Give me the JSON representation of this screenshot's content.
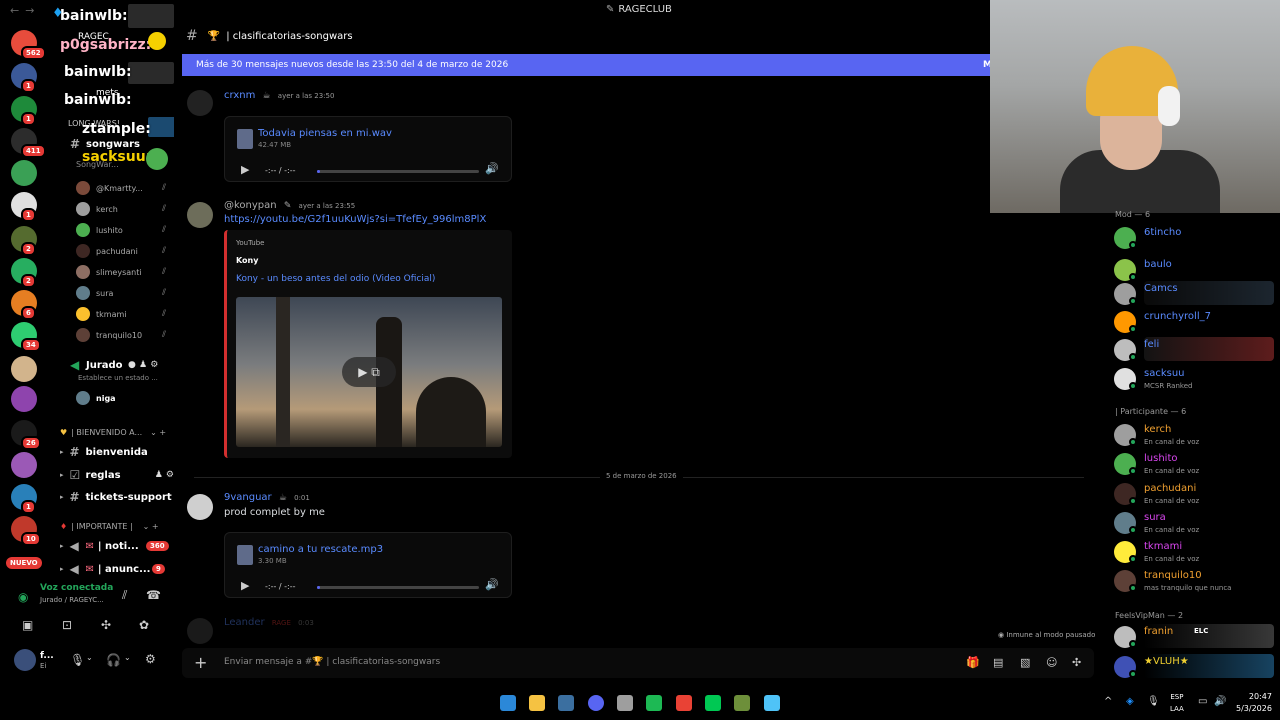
{
  "titlebar": {
    "server_name": "RAGECLUB"
  },
  "server_rail": {
    "servers": [
      {
        "name": "server-1",
        "badge": "562",
        "color": "#e74c3c"
      },
      {
        "name": "server-2",
        "badge": "1",
        "color": "#3b5998"
      },
      {
        "name": "server-3",
        "badge": "1",
        "color": "#1e8a3a"
      },
      {
        "name": "server-4",
        "badge": "411",
        "color": "#2c2c2c"
      },
      {
        "name": "server-5",
        "badge": "",
        "color": "#3aa055"
      },
      {
        "name": "server-6",
        "badge": "1",
        "color": "#e0e0e0"
      },
      {
        "name": "server-7",
        "badge": "2",
        "color": "#556b2f"
      },
      {
        "name": "server-8",
        "badge": "2",
        "color": "#27ae60"
      },
      {
        "name": "server-9",
        "badge": "6",
        "color": "#e67e22"
      },
      {
        "name": "server-10",
        "badge": "34",
        "color": "#2ecc71"
      },
      {
        "name": "server-11",
        "badge": "",
        "color": "#d2b48c"
      },
      {
        "name": "server-12",
        "badge": "",
        "color": "#8e44ad"
      },
      {
        "name": "server-13",
        "badge": "26",
        "color": "#1a1a1a"
      },
      {
        "name": "server-14",
        "badge": "",
        "color": "#9b59b6"
      },
      {
        "name": "server-15",
        "badge": "1",
        "color": "#2980b9"
      },
      {
        "name": "server-16",
        "badge": "10",
        "color": "#c0392b"
      }
    ],
    "nuevo_label": "NUEVO"
  },
  "sidebar": {
    "overlay_names": [
      "bainwlb:",
      "p0gsabrizz:",
      "bainwlb:",
      "bainwlb:",
      "ztample:",
      "sacksuu:"
    ],
    "overlay_small": [
      "RAGEC",
      "mets",
      "LONG WARS!",
      "SongWar..."
    ],
    "songwars_label": "songwars",
    "voice_users": [
      "@Kmartty...",
      "kerch",
      "lushito",
      "pachudani",
      "slimeysanti",
      "sura",
      "tkmami",
      "tranquilo10"
    ],
    "jurado": {
      "label": "Jurado",
      "status": "Establece un estado ..."
    },
    "jurado_user": "niga",
    "cat_bienvenido": "| BIENVENIDO A...",
    "ch_bienvenida": "bienvenida",
    "ch_reglas": "reglas",
    "ch_tickets": "tickets-support",
    "cat_importante": "| IMPORTANTE |",
    "ch_noti": "| noti...",
    "noti_badge": "360",
    "ch_anunc": "| anunc...",
    "anunc_badge": "9",
    "voice_connected": "Voz conectada",
    "voice_location": "Jurado / RAGEYC...",
    "user_name": "f...",
    "user_status": "Ei"
  },
  "chat": {
    "channel_name": "| clasificatorias-songwars",
    "new_messages": "Más de 30 mensajes nuevos desde las 23:50 del 4 de marzo de 2026",
    "new_messages_right": "M",
    "msg1": {
      "author": "crxnm",
      "time": "ayer a las 23:50",
      "file_name": "Todavia piensas en mi.wav",
      "file_size": "42.47 MB",
      "time_display": "-:-- / -:--",
      "progress": 0.0
    },
    "msg2": {
      "author": "@konypan",
      "time": "ayer a las 23:55",
      "link": "https://youtu.be/G2f1uuKuWjs?si=TfefEy_996lm8PlX",
      "embed_provider": "YouTube",
      "embed_author": "Kony",
      "embed_title": "Kony - un beso antes del odio (Video Oficial)"
    },
    "date_divider": "5 de marzo de 2026",
    "msg3": {
      "author": "9vanguar",
      "time": "0:01",
      "text": "prod complet by me",
      "file_name": "camino a tu rescate.mp3",
      "file_size": "3.30 MB",
      "time_display": "-:-- / -:--",
      "progress": 0.0
    },
    "msg4": {
      "author": "Leander",
      "tag": "RAGE",
      "time": "0:03"
    },
    "paused_label": "Inmune al modo pausado",
    "composer_placeholder": "Enviar mensaje a #🏆 | clasificatorias-songwars"
  },
  "members": {
    "groups": [
      {
        "label": "Mod — 6",
        "members": [
          {
            "name": "6tincho",
            "status": "",
            "color": "#5a8bff",
            "avatar": "#4caf50"
          },
          {
            "name": "baulo",
            "status": "",
            "color": "#5a8bff",
            "avatar": "#8bc34a"
          },
          {
            "name": "Camcs",
            "status": "",
            "color": "#5a8bff",
            "avatar": "#9e9e9e"
          },
          {
            "name": "crunchyroll_7",
            "status": "",
            "color": "#5a8bff",
            "avatar": "#ff9800"
          },
          {
            "name": "feli",
            "status": "",
            "color": "#5a8bff",
            "avatar": "#bdbdbd"
          },
          {
            "name": "sacksuu",
            "status": "MCSR Ranked",
            "color": "#5a8bff",
            "avatar": "#e0e0e0"
          }
        ]
      },
      {
        "label": "| Participante — 6",
        "members": [
          {
            "name": "kerch",
            "status": "En canal de voz",
            "color": "#f0a030",
            "avatar": "#9e9e9e"
          },
          {
            "name": "lushito",
            "status": "En canal de voz",
            "color": "#d946ef",
            "avatar": "#4caf50"
          },
          {
            "name": "pachudani",
            "status": "En canal de voz",
            "color": "#f0a030",
            "avatar": "#3e2723"
          },
          {
            "name": "sura",
            "status": "En canal de voz",
            "color": "#d946ef",
            "avatar": "#607d8b"
          },
          {
            "name": "tkmami",
            "status": "En canal de voz",
            "color": "#d946ef",
            "avatar": "#ffeb3b"
          },
          {
            "name": "tranquilo10",
            "status": "mas tranquilo que nunca",
            "color": "#f0a030",
            "avatar": "#5d4037"
          }
        ]
      },
      {
        "label": "FeelsVipMan — 2",
        "members": [
          {
            "name": "franin",
            "status": "",
            "tag": "ELC",
            "color": "#f0a030",
            "avatar": "#bdbdbd"
          },
          {
            "name": "★VLUH★",
            "status": "",
            "color": "#f0d030",
            "avatar": "#3f51b5"
          }
        ]
      }
    ]
  },
  "taskbar": {
    "apps": [
      {
        "name": "windows-start-icon",
        "color": "#2b88d8"
      },
      {
        "name": "file-explorer-icon",
        "color": "#f5c242"
      },
      {
        "name": "steam-icon",
        "color": "#3b6fa0"
      },
      {
        "name": "discord-icon",
        "color": "#5865f2"
      },
      {
        "name": "obs-icon",
        "color": "#9e9e9e"
      },
      {
        "name": "spotify-icon",
        "color": "#1db954"
      },
      {
        "name": "chrome-icon",
        "color": "#e94235"
      },
      {
        "name": "app-green-icon",
        "color": "#00c853"
      },
      {
        "name": "minecraft-icon",
        "color": "#6d8f3a"
      },
      {
        "name": "notepad-icon",
        "color": "#4fc3f7"
      }
    ],
    "lang_top": "ESP",
    "lang_bottom": "LAA",
    "time": "20:47",
    "date": "5/3/2026"
  }
}
